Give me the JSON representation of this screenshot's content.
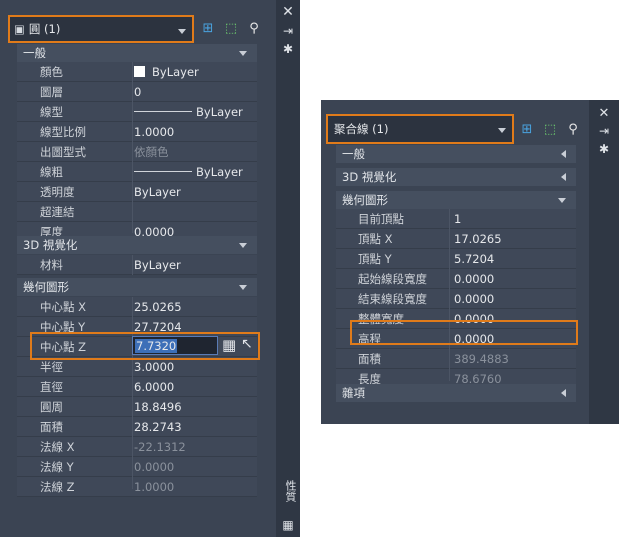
{
  "palette_a": {
    "object_selector": "圓 (1)",
    "categories": {
      "general": "一般",
      "view3d": "3D 視覺化",
      "geometry": "幾何圖形"
    },
    "general_rows": [
      {
        "label": "顏色",
        "value": "ByLayer"
      },
      {
        "label": "圖層",
        "value": "0"
      },
      {
        "label": "線型",
        "value": "ByLayer"
      },
      {
        "label": "線型比例",
        "value": "1.0000"
      },
      {
        "label": "出圖型式",
        "value": "依顏色"
      },
      {
        "label": "線粗",
        "value": "ByLayer"
      },
      {
        "label": "透明度",
        "value": "ByLayer"
      },
      {
        "label": "超連結",
        "value": ""
      },
      {
        "label": "厚度",
        "value": "0.0000"
      }
    ],
    "view3d_rows": [
      {
        "label": "材料",
        "value": "ByLayer"
      }
    ],
    "geometry_rows": [
      {
        "label": "中心點 X",
        "value": "25.0265"
      },
      {
        "label": "中心點 Y",
        "value": "27.7204"
      },
      {
        "label": "中心點 Z",
        "value": "7.7320"
      },
      {
        "label": "半徑",
        "value": "3.0000"
      },
      {
        "label": "直徑",
        "value": "6.0000"
      },
      {
        "label": "圓周",
        "value": "18.8496"
      },
      {
        "label": "面積",
        "value": "28.2743"
      },
      {
        "label": "法線 X",
        "value": "-22.1312"
      },
      {
        "label": "法線 Y",
        "value": "0.0000"
      },
      {
        "label": "法線 Z",
        "value": "1.0000"
      }
    ],
    "side_tab": "性質"
  },
  "palette_b": {
    "object_selector": "聚合線 (1)",
    "categories": {
      "general": "一般",
      "view3d": "3D 視覺化",
      "geometry": "幾何圖形",
      "misc": "雜項"
    },
    "geometry_rows": [
      {
        "label": "目前頂點",
        "value": "1"
      },
      {
        "label": "頂點 X",
        "value": "17.0265"
      },
      {
        "label": "頂點 Y",
        "value": "5.7204"
      },
      {
        "label": "起始線段寬度",
        "value": "0.0000"
      },
      {
        "label": "結束線段寬度",
        "value": "0.0000"
      },
      {
        "label": "整體寬度",
        "value": "0.0000"
      },
      {
        "label": "高程",
        "value": "0.0000"
      },
      {
        "label": "面積",
        "value": "389.4883"
      },
      {
        "label": "長度",
        "value": "78.6760"
      }
    ]
  },
  "colors": {
    "highlight": "#e07b1a",
    "panel": "#3b4453"
  }
}
